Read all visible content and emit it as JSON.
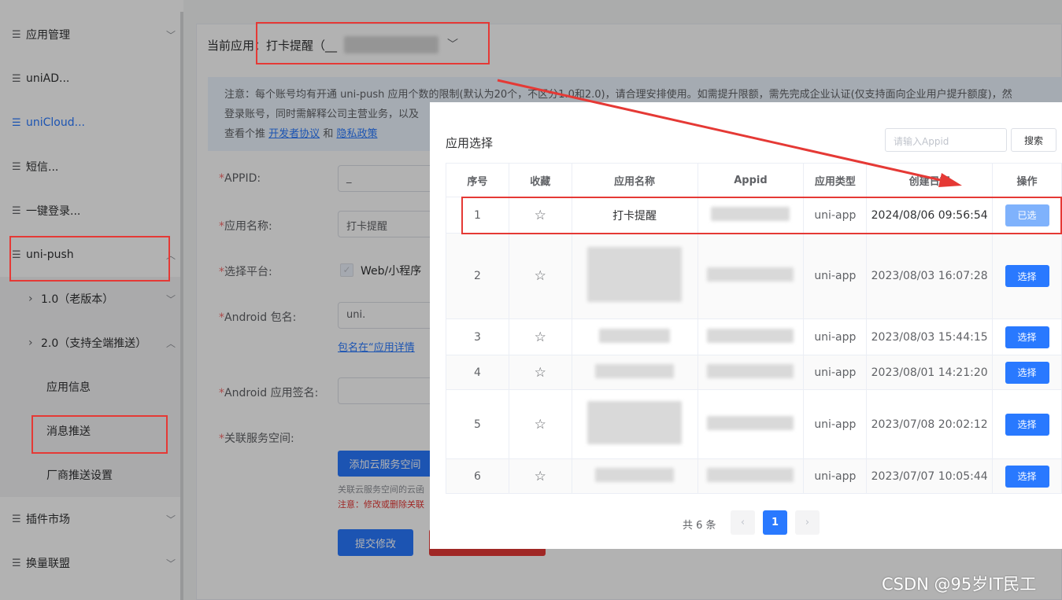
{
  "sidebar": {
    "items": [
      {
        "label": "应用管理"
      },
      {
        "label": "uniAD..."
      },
      {
        "label": "uniCloud..."
      },
      {
        "label": "短信..."
      },
      {
        "label": "一键登录..."
      },
      {
        "label": "uni-push"
      },
      {
        "label": "1.0（老版本）"
      },
      {
        "label": "2.0（支持全端推送）"
      },
      {
        "label": "应用信息"
      },
      {
        "label": "消息推送"
      },
      {
        "label": "厂商推送设置"
      },
      {
        "label": "插件市场"
      },
      {
        "label": "换量联盟"
      }
    ]
  },
  "header": {
    "current_app_label": "当前应用：打卡提醒（__"
  },
  "notice": {
    "line1": "注意：每个账号均有开通 uni-push 应用个数的限制(默认为20个，不区分1.0和2.0)，请合理安排使用。如需提升限额，需先完成企业认证(仅支持面向企业用户提升额度)，然",
    "line2": "登录账号，同时需解释公司主营业务，以及",
    "line3_prefix": "查看个推",
    "link_dev": "开发者协议",
    "and": "和",
    "link_privacy": "隐私政策"
  },
  "form": {
    "appid_label": "APPID:",
    "appid_value": "_",
    "name_label": "应用名称:",
    "name_value": "打卡提醒",
    "platform_label": "选择平台:",
    "platform_option": "Web/小程序",
    "android_pkg_label": "Android 包名:",
    "android_pkg_value": "uni.",
    "pkg_hint": "包名在“应用详情",
    "android_sign_label": "Android 应用签名:",
    "cloud_space_label": "关联服务空间:",
    "add_cloud_button": "添加云服务空间",
    "cloud_hint": "关联云服务空间的云函",
    "cloud_warning": "注意：修改或删除关联",
    "submit_button": "提交修改"
  },
  "dialog": {
    "title": "应用选择",
    "search_placeholder": "请输入Appid",
    "search_button": "搜索",
    "columns": [
      "序号",
      "收藏",
      "应用名称",
      "Appid",
      "应用类型",
      "创建日期",
      "操作"
    ],
    "rows": [
      {
        "no": "1",
        "name": "打卡提醒",
        "type": "uni-app",
        "date": "2024/08/06 09:56:54",
        "action": "已选",
        "selected": true
      },
      {
        "no": "2",
        "name": "",
        "type": "uni-app",
        "date": "2023/08/03 16:07:28",
        "action": "选择",
        "selected": false
      },
      {
        "no": "3",
        "name": "",
        "type": "uni-app",
        "date": "2023/08/03 15:44:15",
        "action": "选择",
        "selected": false
      },
      {
        "no": "4",
        "name": "",
        "type": "uni-app",
        "date": "2023/08/01 14:21:20",
        "action": "选择",
        "selected": false
      },
      {
        "no": "5",
        "name": "",
        "type": "uni-app",
        "date": "2023/07/08 20:02:12",
        "action": "选择",
        "selected": false
      },
      {
        "no": "6",
        "name": "",
        "type": "uni-app",
        "date": "2023/07/07 10:05:44",
        "action": "选择",
        "selected": false
      }
    ],
    "total": "共 6 条",
    "current_page": "1"
  },
  "watermark": "CSDN @95岁IT民工",
  "colors": {
    "accent": "#2979ff",
    "annotation": "#e53935"
  },
  "icons": {
    "menu": "hamburger-icon",
    "chevron": "chevron-icon",
    "star": "star-outline-icon"
  }
}
